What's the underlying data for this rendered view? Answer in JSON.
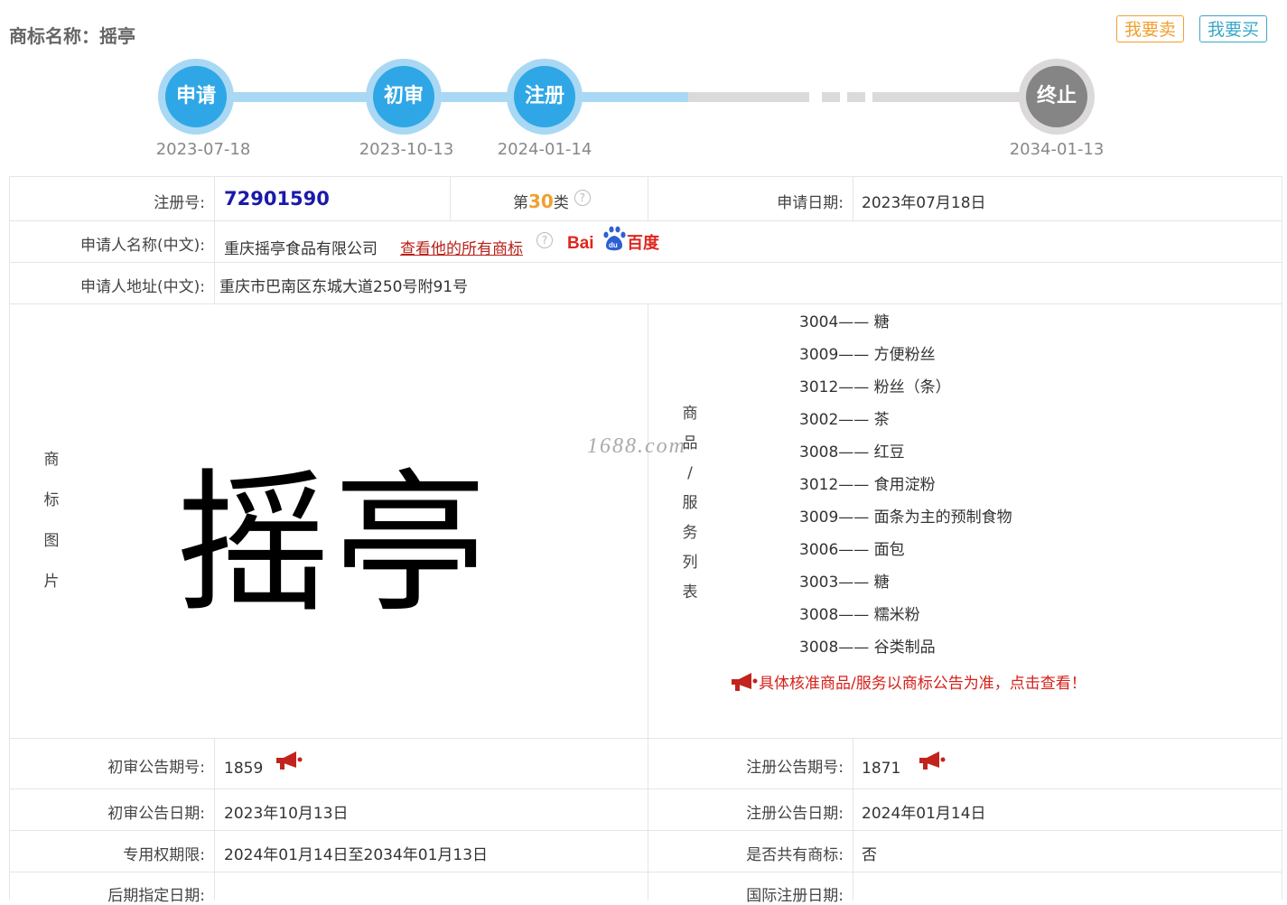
{
  "header": {
    "title": "商标名称：摇亭",
    "sell_label": "我要卖",
    "buy_label": "我要买"
  },
  "timeline": [
    {
      "label": "申请",
      "date": "2023-07-18",
      "state": "done"
    },
    {
      "label": "初审",
      "date": "2023-10-13",
      "state": "done"
    },
    {
      "label": "注册",
      "date": "2024-01-14",
      "state": "done"
    },
    {
      "label": "终止",
      "date": "2034-01-13",
      "state": "pending"
    }
  ],
  "info": {
    "reg_no_label": "注册号:",
    "reg_no": "72901590",
    "class_prefix": "第",
    "class_no": "30",
    "class_suffix": "类",
    "apply_date_label": "申请日期:",
    "apply_date": "2023年07月18日",
    "applicant_label": "申请人名称(中文):",
    "applicant": "重庆摇亭食品有限公司",
    "view_all_link": "查看他的所有商标",
    "baidu_text": "Bai百度",
    "address_label": "申请人地址(中文):",
    "address": "重庆市巴南区东城大道250号附91号",
    "image_label_chars": [
      "商",
      "标",
      "图",
      "片"
    ],
    "mark_text": "摇亭",
    "watermark": "1688.com",
    "goods_label_chars": [
      "商",
      "品",
      "/",
      "服",
      "务",
      "列",
      "表"
    ],
    "goods": [
      "3004—— 糖",
      "3009—— 方便粉丝",
      "3012—— 粉丝（条）",
      "3002—— 茶",
      "3008—— 红豆",
      "3012—— 食用淀粉",
      "3009—— 面条为主的预制食物",
      "3006—— 面包",
      "3003—— 糖",
      "3008—— 糯米粉",
      "3008—— 谷类制品"
    ],
    "goods_notice": "具体核准商品/服务以商标公告为准，点击查看！",
    "prelim_issue_label": "初审公告期号:",
    "prelim_issue": "1859",
    "reg_issue_label": "注册公告期号:",
    "reg_issue": "1871",
    "prelim_date_label": "初审公告日期:",
    "prelim_date": "2023年10月13日",
    "reg_date_label": "注册公告日期:",
    "reg_date": "2024年01月14日",
    "period_label": "专用权期限:",
    "period": "2024年01月14日至2034年01月13日",
    "shared_label": "是否共有商标:",
    "shared": "否",
    "later_label": "后期指定日期:",
    "intl_label": "国际注册日期:"
  },
  "colors": {
    "accent": "#2fa7e6",
    "progress": "#a9d8f4",
    "pending": "#858585",
    "red": "#d6201a",
    "regno": "#1a1aa8",
    "class": "#f0a030"
  }
}
